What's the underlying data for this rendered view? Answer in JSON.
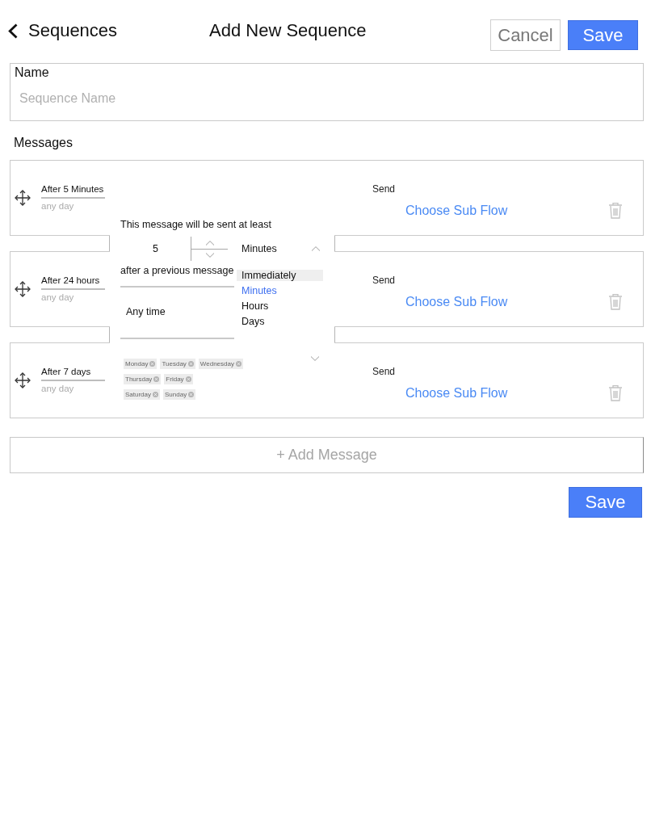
{
  "header": {
    "back_label": "Sequences",
    "title": "Add New Sequence",
    "buttons": [
      {
        "label": "Cancel",
        "kind": "secondary"
      },
      {
        "label": "Save",
        "kind": "primary"
      }
    ]
  },
  "name_field": {
    "label": "Name",
    "placeholder": "Sequence Name"
  },
  "messages": {
    "label": "Messages",
    "items": [
      {
        "delay": "After 5 Minutes",
        "days": "any day",
        "send_label": "Send",
        "action": "Choose Sub Flow"
      },
      {
        "delay": "After 24 hours",
        "days": "any day",
        "send_label": "Send",
        "action": "Choose Sub Flow"
      },
      {
        "delay": "After 7 days",
        "days": "any day",
        "send_label": "Send",
        "action": "Choose Sub Flow"
      }
    ]
  },
  "schedule_popover": {
    "intro": "This message will be sent at least",
    "amount": "5",
    "unit_select": {
      "value": "Minutes",
      "expanded": true,
      "options": [
        {
          "label": "Immediately",
          "highlighted": true,
          "selected": false
        },
        {
          "label": "Minutes",
          "highlighted": false,
          "selected": true
        },
        {
          "label": "Hours",
          "highlighted": false,
          "selected": false
        },
        {
          "label": "Days",
          "highlighted": false,
          "selected": false
        }
      ]
    },
    "suffix": "after a previous message",
    "time": "Any time",
    "days_select": {
      "expanded": false,
      "rows": [
        [
          "Monday",
          "Tuesday",
          "Wednesday"
        ],
        [
          "Thursday",
          "Friday"
        ],
        [
          "Saturday",
          "Sunday"
        ]
      ]
    }
  },
  "add_message": {
    "label": "+ Add Message"
  },
  "footer_button": {
    "label": "Save",
    "kind": "primary"
  }
}
